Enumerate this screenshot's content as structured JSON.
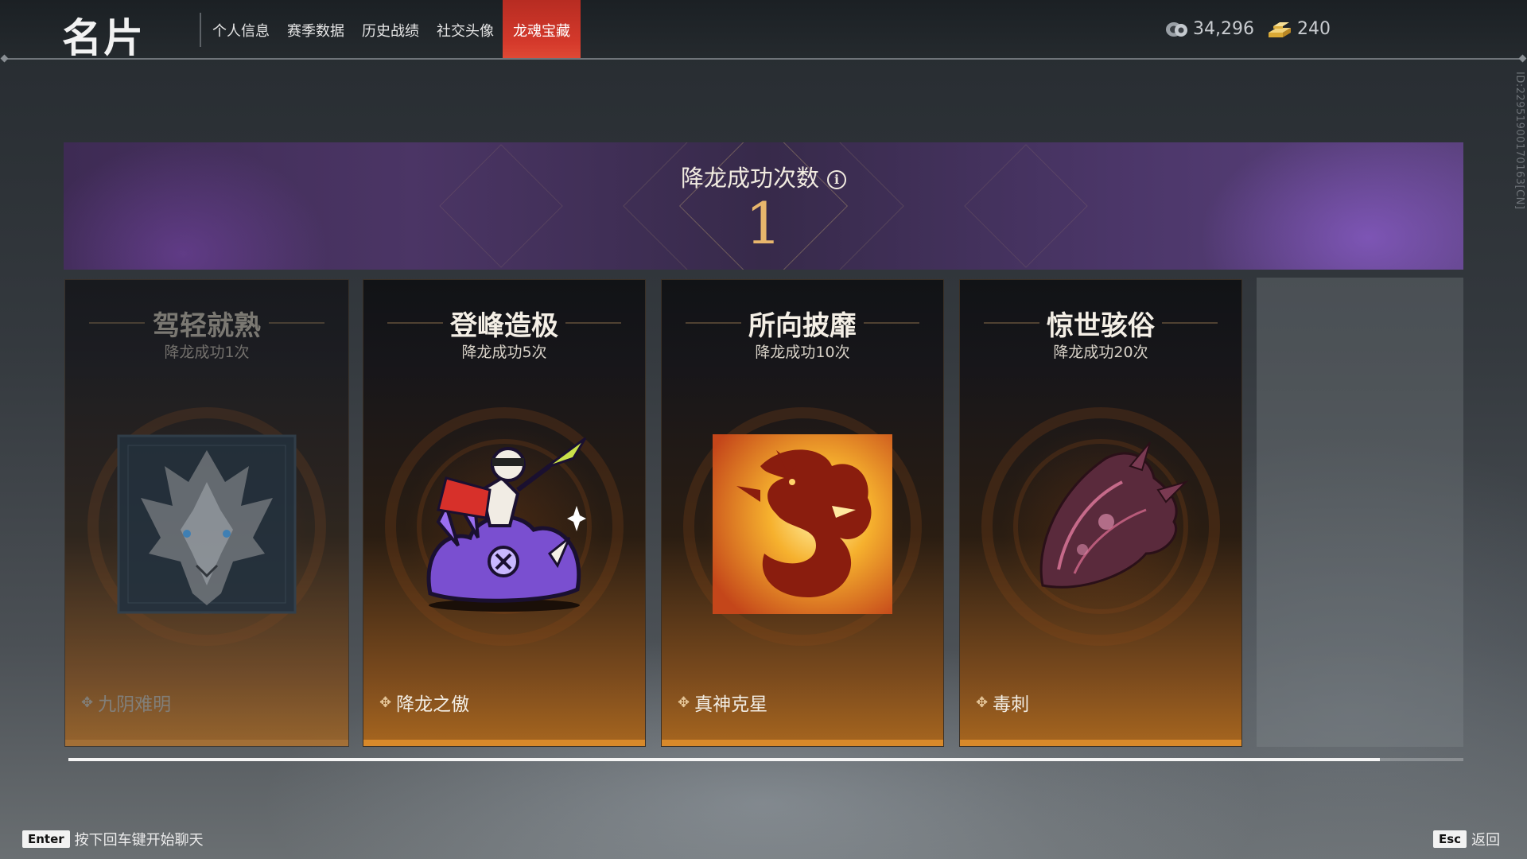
{
  "header": {
    "title": "名片",
    "tabs": [
      {
        "label": "个人信息",
        "active": false
      },
      {
        "label": "赛季数据",
        "active": false
      },
      {
        "label": "历史战绩",
        "active": false
      },
      {
        "label": "社交头像",
        "active": false
      },
      {
        "label": "龙魂宝藏",
        "active": true
      }
    ],
    "currency_a": {
      "icon": "coin-stack-icon",
      "value": "34,296"
    },
    "currency_b": {
      "icon": "gold-bar-icon",
      "value": "240"
    }
  },
  "side_id": "ID:22951900170163[CN]",
  "banner": {
    "title": "降龙成功次数",
    "count": "1",
    "info_icon": "info-icon"
  },
  "cards": [
    {
      "title": "驾轻就熟",
      "requirement": "降龙成功1次",
      "reward": "九阴难明",
      "state": "locked",
      "image": "silver-dragon-mask-icon"
    },
    {
      "title": "登峰造极",
      "requirement": "降龙成功5次",
      "reward": "降龙之傲",
      "state": "unlocked",
      "image": "hero-on-purple-dragon-icon"
    },
    {
      "title": "所向披靡",
      "requirement": "降龙成功10次",
      "reward": "真神克星",
      "state": "unlocked",
      "image": "fire-dragon-icon"
    },
    {
      "title": "惊世骇俗",
      "requirement": "降龙成功20次",
      "reward": "毒刺",
      "state": "unlocked",
      "image": "ornate-gauntlet-icon"
    }
  ],
  "scroll_progress": 0.94,
  "footer": {
    "left_key": "Enter",
    "left_text": "按下回车键开始聊天",
    "right_key": "Esc",
    "right_text": "返回"
  },
  "colors": {
    "accent_red": "#d4392b",
    "gold": "#e8b66c",
    "card_bar": "#d8892a"
  }
}
